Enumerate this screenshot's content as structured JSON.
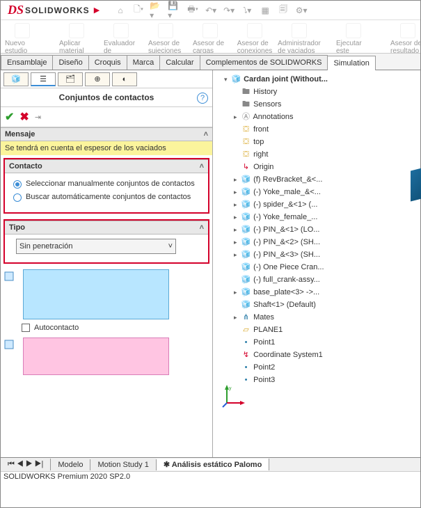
{
  "app": {
    "name": "SOLIDWORKS"
  },
  "quick_access_icons": [
    "home",
    "new",
    "open",
    "save",
    "print",
    "undo",
    "redo",
    "select",
    "rebuild",
    "options",
    "settings"
  ],
  "ribbon": [
    {
      "label": "Nuevo estudio"
    },
    {
      "label": "Aplicar material"
    },
    {
      "label": "Evaluador de simulación"
    },
    {
      "label": "Asesor de sujeciones"
    },
    {
      "label": "Asesor de cargas externas"
    },
    {
      "label": "Asesor de conexiones"
    },
    {
      "label": "Administrador de vaciados"
    },
    {
      "label": "Ejecutar este estudio"
    },
    {
      "label": "Asesor de resultado"
    }
  ],
  "tabs": [
    "Ensamblaje",
    "Diseño",
    "Croquis",
    "Marca",
    "Calcular",
    "Complementos de SOLIDWORKS",
    "Simulation"
  ],
  "tabs_active": "Simulation",
  "panel": {
    "title": "Conjuntos de contactos",
    "msg_header": "Mensaje",
    "msg_body": "Se tendrá en cuenta el espesor de los vaciados",
    "contact_header": "Contacto",
    "contact_opts": [
      "Seleccionar manualmente conjuntos de contactos",
      "Buscar automáticamente conjuntos de contactos"
    ],
    "contact_selected": 0,
    "tipo_header": "Tipo",
    "tipo_value": "Sin penetración",
    "autocontact_label": "Autocontacto"
  },
  "tree": {
    "root": "Cardan joint  (Without...",
    "items": [
      {
        "icon": "folder",
        "label": "History"
      },
      {
        "icon": "folder",
        "label": "Sensors"
      },
      {
        "icon": "ann",
        "label": "Annotations",
        "exp": true
      },
      {
        "icon": "view",
        "label": "front"
      },
      {
        "icon": "view",
        "label": "top"
      },
      {
        "icon": "view",
        "label": "right"
      },
      {
        "icon": "origin",
        "label": "Origin"
      },
      {
        "icon": "part",
        "label": "(f) RevBracket_&<...",
        "exp": true
      },
      {
        "icon": "part",
        "label": "(-) Yoke_male_&<...",
        "exp": true
      },
      {
        "icon": "part",
        "label": "(-) spider_&<1> (...",
        "exp": true
      },
      {
        "icon": "part",
        "label": "(-) Yoke_female_...",
        "exp": true
      },
      {
        "icon": "part",
        "label": "(-) PIN_&<1> (LO...",
        "exp": true
      },
      {
        "icon": "part",
        "label": "(-) PIN_&<2> (SH...",
        "exp": true
      },
      {
        "icon": "part",
        "label": "(-) PIN_&<3> (SH...",
        "exp": true
      },
      {
        "icon": "partg",
        "label": "(-) One Piece Cran..."
      },
      {
        "icon": "partg",
        "label": "(-) full_crank-assy..."
      },
      {
        "icon": "part",
        "label": "base_plate<3> ->...",
        "exp": true
      },
      {
        "icon": "partg",
        "label": "Shaft<1> (Default)"
      },
      {
        "icon": "mate",
        "label": "Mates",
        "exp": true
      },
      {
        "icon": "plane",
        "label": "PLANE1"
      },
      {
        "icon": "pt",
        "label": "Point1"
      },
      {
        "icon": "cs",
        "label": "Coordinate System1"
      },
      {
        "icon": "pt",
        "label": "Point2"
      },
      {
        "icon": "pt",
        "label": "Point3"
      }
    ]
  },
  "bottom_tabs": {
    "items": [
      "Modelo",
      "Motion Study 1",
      "Análisis estático Palomo"
    ],
    "active": "Análisis estático Palomo",
    "prefix": "▶"
  },
  "status": "SOLIDWORKS Premium 2020 SP2.0"
}
